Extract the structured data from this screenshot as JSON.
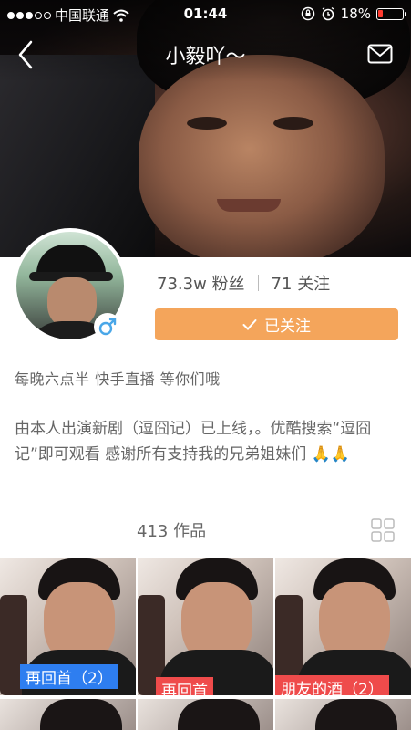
{
  "status_bar": {
    "carrier": "中国联通",
    "time": "01:44",
    "battery": "18%"
  },
  "header": {
    "title": "小毅吖～"
  },
  "profile": {
    "fans_count": "73.3w",
    "fans_label": "粉丝",
    "following_count": "71",
    "following_label": "关注",
    "follow_button": "已关注",
    "gender": "male"
  },
  "bio": {
    "line1": "每晚六点半  快手直播  等你们哦",
    "line2": "由本人出演新剧（逗囧记）已上线，。优酷搜索“逗囧记”即可观看 感谢所有支持我的兄弟姐妹们 🙏🙏"
  },
  "works": {
    "count": "413",
    "label": "作品",
    "items": [
      {
        "label": "再回首（2）",
        "color": "#2e7ef0"
      },
      {
        "label": "再回首",
        "color": "#ef4b4b"
      },
      {
        "label": "朋友的酒（2）",
        "color": "#ef4b4b"
      }
    ]
  },
  "colors": {
    "accent": "#f4a55b",
    "blue_tag": "#2e7ef0",
    "red_tag": "#ef4b4b"
  },
  "icons": [
    "back-icon",
    "mail-icon",
    "wifi-icon",
    "lock-rotation-icon",
    "alarm-icon",
    "battery-icon",
    "male-icon",
    "check-icon",
    "grid-view-icon"
  ]
}
